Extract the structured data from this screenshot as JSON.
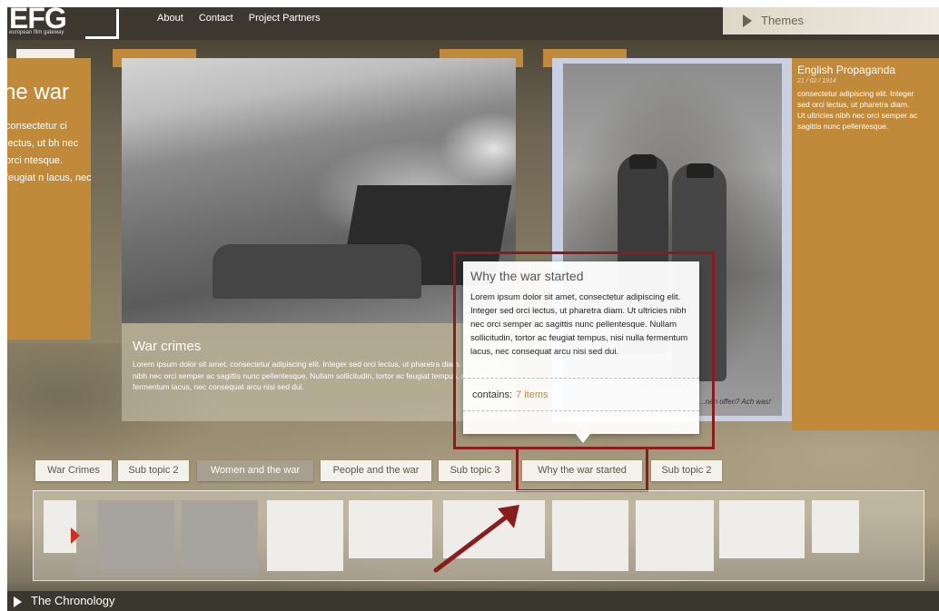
{
  "header": {
    "logo_text": "EFG",
    "logo_subtext": "european film gateway",
    "nav": [
      "About",
      "Contact",
      "Project Partners"
    ],
    "themes_label": "Themes"
  },
  "left_card": {
    "title": "he war",
    "text": "consectetur ci lectus, ut bh nec orci ntesque. feugiat n lacus, nec"
  },
  "war_crimes_card": {
    "title": "War crimes",
    "text": "Lorem ipsum dolor sit amet, consectetur adipiscing elit. Integer sed orci lectus, ut pharetra diam. Ut ultricies nibh nec orci semper ac sagittis nunc pellentesque. Nullam sollicitudin, tortor ac feugiat tempus, nisi nulla fermentum lacus, nec consequat arcu nisi sed dui."
  },
  "propaganda_card": {
    "title": "English Propaganda",
    "date": "21 / 02 / 1914",
    "text_lines": [
      "consectetur adipiscing elit. Integer",
      "sed orci lectus, ut pharetra diam.",
      "Ut ultricies nibh nec orci semper ac",
      "sagittis nunc pellentesque."
    ],
    "photo_caption": "...nen offen? Ach was!"
  },
  "popup": {
    "title": "Why the war started",
    "text": "Lorem ipsum dolor sit amet, consectetur adipiscing elit. Integer sed orci lectus, ut pharetra diam. Ut ultricies nibh nec orci semper ac sagittis nunc pellentesque. Nullam sollicitudin, tortor ac feugiat tempus, nisi nulla fermentum lacus, nec consequat arcu nisi sed dui.",
    "contains_label": "contains:",
    "contains_count": "7 items"
  },
  "topics": [
    "War Crimes",
    "Sub topic 2",
    "Women and the war",
    "People and the war",
    "Sub topic 3",
    "Why the war started",
    "Sub topic 2"
  ],
  "footer": {
    "chronology_label": "The Chronology"
  },
  "colors": {
    "accent": "#c18a3b",
    "highlight": "#8a1c1c",
    "arrow_red": "#d32d22"
  }
}
